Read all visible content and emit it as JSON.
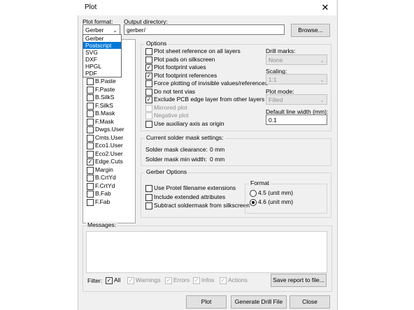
{
  "window": {
    "title": "Plot",
    "close_glyph": "✕"
  },
  "plot_format": {
    "label": "Plot format:",
    "value": "Gerber",
    "options": [
      "Gerber",
      "Postscript",
      "SVG",
      "DXF",
      "HPGL",
      "PDF"
    ],
    "highlighted": "Postscript"
  },
  "output_dir": {
    "label": "Output directory:",
    "value": "gerber/",
    "browse_label": "Browse..."
  },
  "layers": [
    {
      "name": "B.Paste",
      "checked": false
    },
    {
      "name": "F.Paste",
      "checked": false
    },
    {
      "name": "B.SilkS",
      "checked": false
    },
    {
      "name": "F.SilkS",
      "checked": false
    },
    {
      "name": "B.Mask",
      "checked": false
    },
    {
      "name": "F.Mask",
      "checked": false
    },
    {
      "name": "Dwgs.User",
      "checked": false
    },
    {
      "name": "Cmts.User",
      "checked": false
    },
    {
      "name": "Eco1.User",
      "checked": false
    },
    {
      "name": "Eco2.User",
      "checked": false
    },
    {
      "name": "Edge.Cuts",
      "checked": true
    },
    {
      "name": "Margin",
      "checked": false
    },
    {
      "name": "B.CrtYd",
      "checked": false
    },
    {
      "name": "F.CrtYd",
      "checked": false
    },
    {
      "name": "B.Fab",
      "checked": false
    },
    {
      "name": "F.Fab",
      "checked": false
    }
  ],
  "options": {
    "title": "Options",
    "items": [
      {
        "label": "Plot sheet reference on all layers",
        "checked": false,
        "disabled": false
      },
      {
        "label": "Plot pads on silkscreen",
        "checked": false,
        "disabled": false
      },
      {
        "label": "Plot footprint values",
        "checked": true,
        "disabled": false
      },
      {
        "label": "Plot footprint references",
        "checked": true,
        "disabled": false
      },
      {
        "label": "Force plotting of invisible values/references",
        "checked": false,
        "disabled": false
      },
      {
        "label": "Do not tent vias",
        "checked": false,
        "disabled": false
      },
      {
        "label": "Exclude PCB edge layer from other layers",
        "checked": true,
        "disabled": false
      },
      {
        "label": "Mirrored plot",
        "checked": false,
        "disabled": true
      },
      {
        "label": "Negative plot",
        "checked": false,
        "disabled": true
      },
      {
        "label": "Use auxiliary axis as origin",
        "checked": false,
        "disabled": false
      }
    ],
    "drill_marks": {
      "label": "Drill marks:",
      "value": "None"
    },
    "scaling": {
      "label": "Scaling:",
      "value": "1:1"
    },
    "plot_mode": {
      "label": "Plot mode:",
      "value": "Filled"
    },
    "line_width": {
      "label": "Default line width (mm):",
      "value": "0.1"
    }
  },
  "solder_mask": {
    "title": "Current solder mask settings:",
    "clearance_label": "Solder mask clearance:",
    "clearance_value": "0 mm",
    "min_width_label": "Solder mask min width:",
    "min_width_value": "0 mm"
  },
  "gerber": {
    "title": "Gerber Options",
    "items": [
      {
        "label": "Use Protel filename extensions",
        "checked": false
      },
      {
        "label": "Include extended attributes",
        "checked": false
      },
      {
        "label": "Subtract soldermask from silkscreen",
        "checked": false
      }
    ],
    "format": {
      "title": "Format",
      "options": [
        {
          "label": "4.5 (unit mm)",
          "selected": false
        },
        {
          "label": "4.6 (unit mm)",
          "selected": true
        }
      ]
    }
  },
  "messages": {
    "title": "Messages:",
    "filter_label": "Filter:",
    "filters": [
      {
        "label": "All",
        "checked": true,
        "disabled": false
      },
      {
        "label": "Warnings",
        "checked": true,
        "disabled": true
      },
      {
        "label": "Errors",
        "checked": true,
        "disabled": true
      },
      {
        "label": "Infos",
        "checked": true,
        "disabled": true
      },
      {
        "label": "Actions",
        "checked": true,
        "disabled": true
      }
    ],
    "save_label": "Save report to file..."
  },
  "buttons": {
    "plot": "Plot",
    "drill": "Generate Drill File",
    "close": "Close"
  }
}
